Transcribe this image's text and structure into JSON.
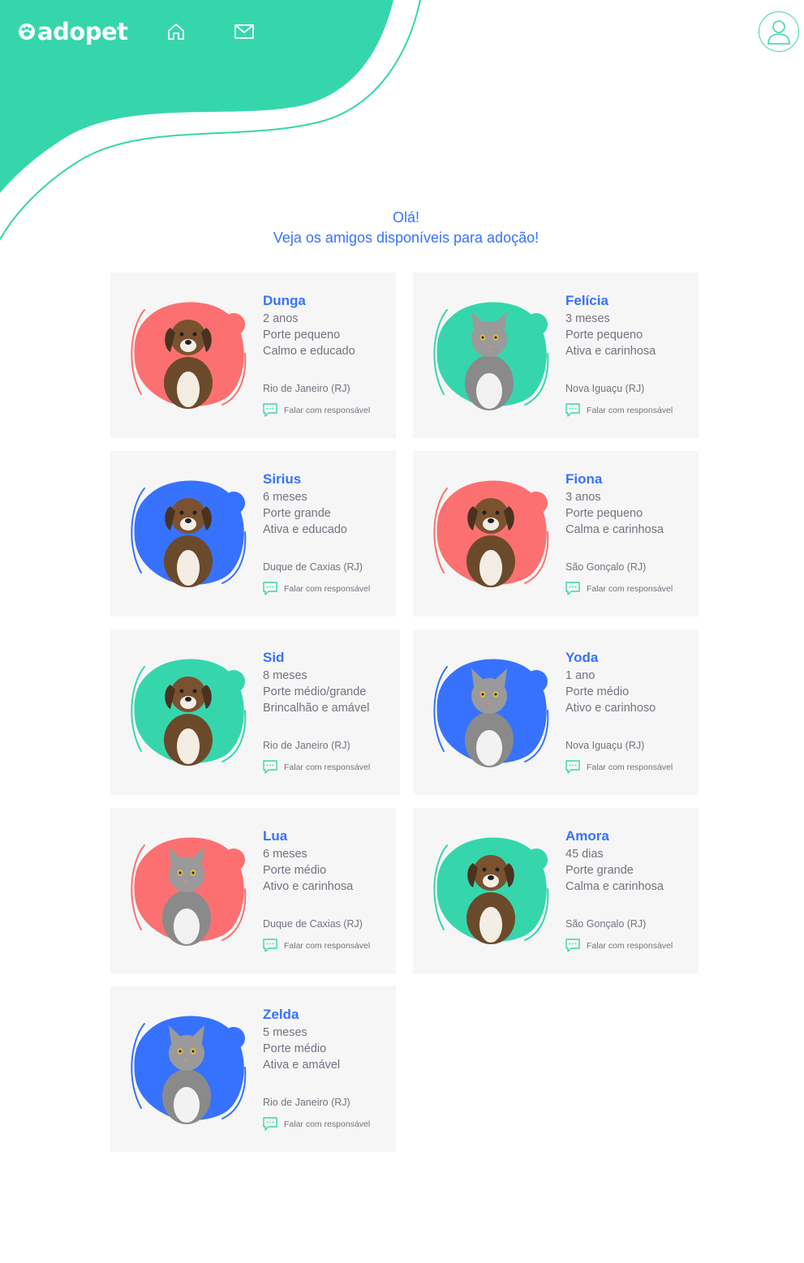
{
  "header": {
    "logo": "adopet",
    "nav": {
      "home_icon": "home-icon",
      "messages_icon": "mail-icon"
    },
    "profile_icon": "user-icon"
  },
  "greeting": {
    "line1": "Olá!",
    "line2": "Veja os amigos disponíveis para adoção!"
  },
  "colors": {
    "brand_green": "#36D6AD",
    "brand_blue": "#3772FF",
    "brand_red": "#FC7071",
    "text_gray": "#737380",
    "card_bg": "#F6F6F6"
  },
  "contact_label": "Falar com responsável",
  "pets": [
    {
      "name": "Dunga",
      "age": "2 anos",
      "size": "Porte pequeno",
      "temper": "Calmo e educado",
      "location": "Rio de Janeiro (RJ)",
      "blob": "#FC7071",
      "animal": "dog"
    },
    {
      "name": "Felícia",
      "age": "3 meses",
      "size": "Porte pequeno",
      "temper": "Ativa e carinhosa",
      "location": "Nova Iguaçu (RJ)",
      "blob": "#36D6AD",
      "animal": "cat"
    },
    {
      "name": "Sirius",
      "age": "6 meses",
      "size": "Porte grande",
      "temper": "Ativa e educado",
      "location": "Duque de Caxias (RJ)",
      "blob": "#3772FF",
      "animal": "dog"
    },
    {
      "name": "Fiona",
      "age": "3 anos",
      "size": "Porte pequeno",
      "temper": "Calma e carinhosa",
      "location": "São Gonçalo (RJ)",
      "blob": "#FC7071",
      "animal": "dog"
    },
    {
      "name": "Sid",
      "age": "8 meses",
      "size": "Porte médio/grande",
      "temper": "Brincalhão e amável",
      "location": "Rio de Janeiro (RJ)",
      "blob": "#36D6AD",
      "animal": "dog"
    },
    {
      "name": "Yoda",
      "age": "1 ano",
      "size": "Porte médio",
      "temper": "Ativo e carinhoso",
      "location": "Nova Iguaçu (RJ)",
      "blob": "#3772FF",
      "animal": "cat"
    },
    {
      "name": "Lua",
      "age": "6 meses",
      "size": "Porte médio",
      "temper": "Ativo e carinhosa",
      "location": "Duque de Caxias (RJ)",
      "blob": "#FC7071",
      "animal": "cat"
    },
    {
      "name": "Amora",
      "age": "45 dias",
      "size": "Porte grande",
      "temper": "Calma e carinhosa",
      "location": "São Gonçalo (RJ)",
      "blob": "#36D6AD",
      "animal": "dog"
    },
    {
      "name": "Zelda",
      "age": "5 meses",
      "size": "Porte médio",
      "temper": "Ativa e amável",
      "location": "Rio de Janeiro (RJ)",
      "blob": "#3772FF",
      "animal": "cat"
    }
  ]
}
